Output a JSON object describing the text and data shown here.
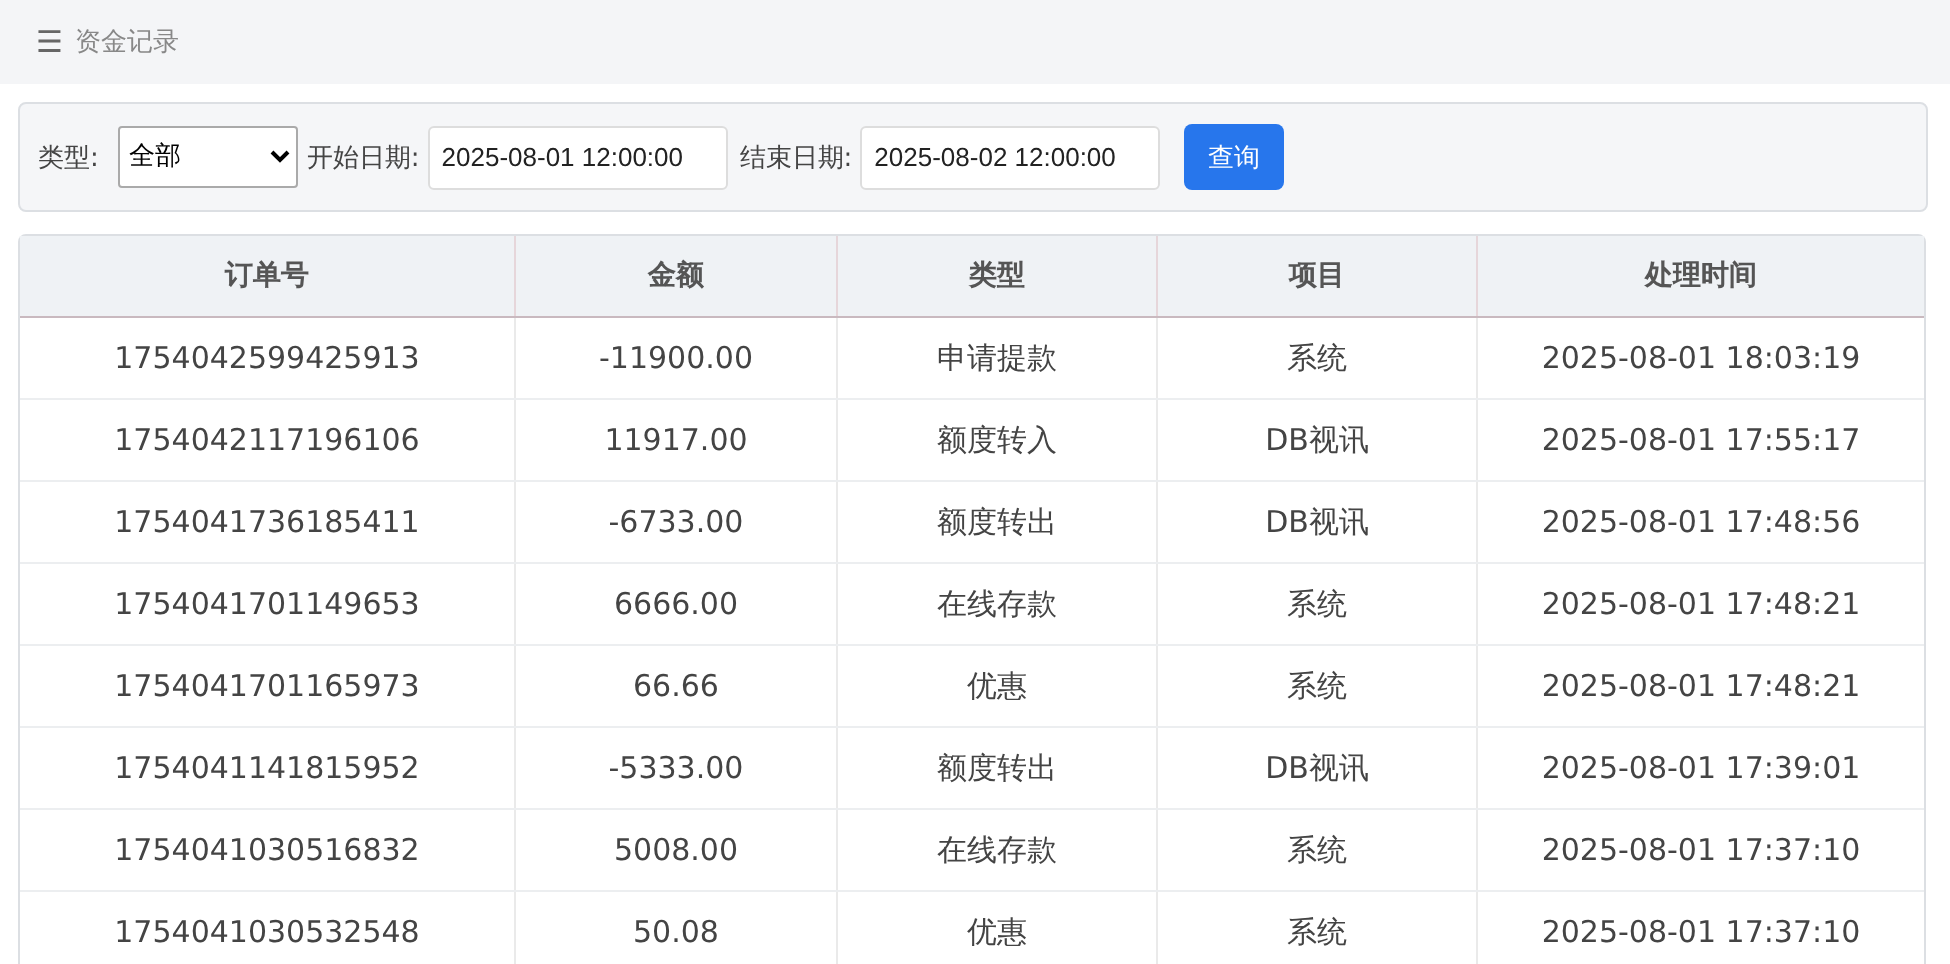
{
  "header": {
    "menu_icon": "☰",
    "title": "资金记录"
  },
  "filters": {
    "type_label": "类型:",
    "type_value": "全部",
    "start_label": "开始日期:",
    "start_value": "2025-08-01 12:00:00",
    "end_label": "结束日期:",
    "end_value": "2025-08-02 12:00:00",
    "button": "查询"
  },
  "table": {
    "columns": [
      "订单号",
      "金额",
      "类型",
      "项目",
      "处理时间"
    ],
    "rows": [
      [
        "1754042599425913",
        "-11900.00",
        "申请提款",
        "系统",
        "2025-08-01 18:03:19"
      ],
      [
        "1754042117196106",
        "11917.00",
        "额度转入",
        "DB视讯",
        "2025-08-01 17:55:17"
      ],
      [
        "1754041736185411",
        "-6733.00",
        "额度转出",
        "DB视讯",
        "2025-08-01 17:48:56"
      ],
      [
        "1754041701149653",
        "6666.00",
        "在线存款",
        "系统",
        "2025-08-01 17:48:21"
      ],
      [
        "1754041701165973",
        "66.66",
        "优惠",
        "系统",
        "2025-08-01 17:48:21"
      ],
      [
        "1754041141815952",
        "-5333.00",
        "额度转出",
        "DB视讯",
        "2025-08-01 17:39:01"
      ],
      [
        "1754041030516832",
        "5008.00",
        "在线存款",
        "系统",
        "2025-08-01 17:37:10"
      ],
      [
        "1754041030532548",
        "50.08",
        "优惠",
        "系统",
        "2025-08-01 17:37:10"
      ]
    ]
  }
}
